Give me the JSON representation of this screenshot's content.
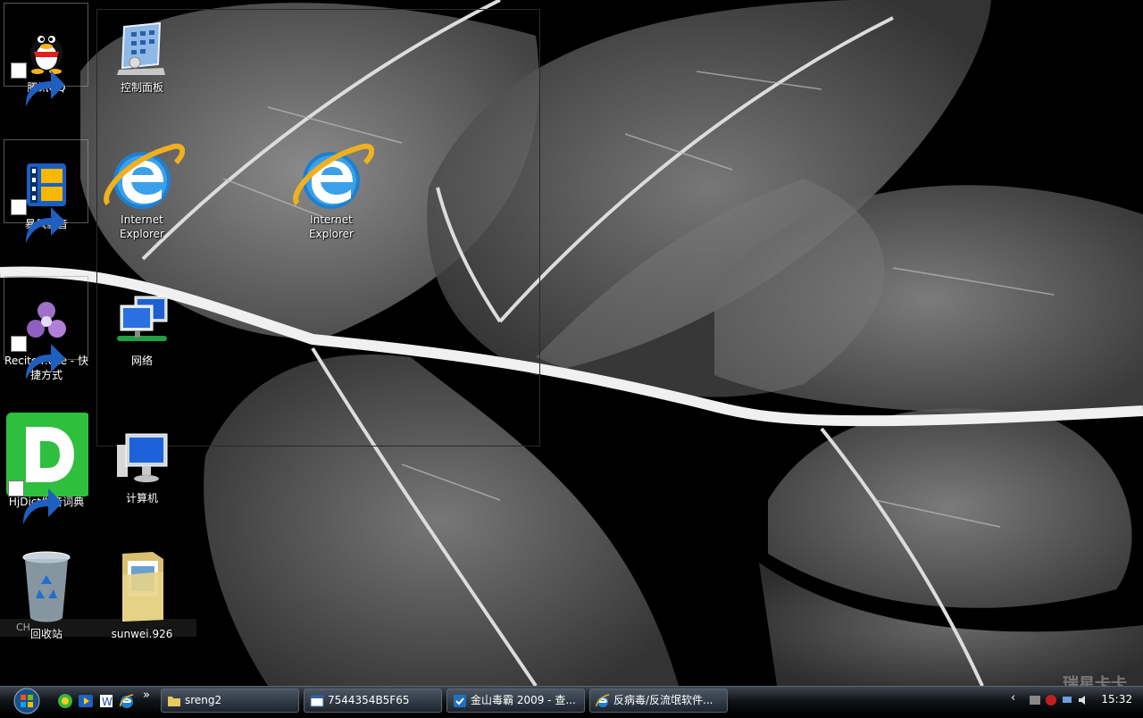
{
  "desktop": {
    "icons": [
      {
        "label": "腾讯QQ",
        "icon": "qq-penguin-icon",
        "shortcut": true
      },
      {
        "label": "控制面板",
        "icon": "control-panel-icon",
        "shortcut": false
      },
      {
        "label": "暴风影音",
        "icon": "storm-player-icon",
        "shortcut": true
      },
      {
        "label": "Internet Explorer",
        "icon": "internet-explorer-icon",
        "shortcut": false
      },
      {
        "label": "Internet Explorer",
        "icon": "internet-explorer-icon",
        "shortcut": false
      },
      {
        "label": "Recite4.exe - 快捷方式",
        "icon": "recite-app-icon",
        "shortcut": true
      },
      {
        "label": "网络",
        "icon": "network-icon",
        "shortcut": false
      },
      {
        "label": "HjDict发音词典",
        "icon": "hjdict-icon",
        "shortcut": true
      },
      {
        "label": "计算机",
        "icon": "computer-icon",
        "shortcut": false
      },
      {
        "label": "回收站",
        "icon": "recycle-bin-icon",
        "shortcut": false
      },
      {
        "label": "sunwei.926",
        "icon": "folder-icon",
        "shortcut": false
      }
    ]
  },
  "ime_bar": {
    "text": "CH"
  },
  "watermark": "瑞星卡卡",
  "taskbar": {
    "start_icon": "windows-orb-icon",
    "quick_launch": [
      {
        "icon": "360-browser-icon"
      },
      {
        "icon": "media-player-icon"
      },
      {
        "icon": "word-app-icon"
      },
      {
        "icon": "internet-explorer-icon"
      }
    ],
    "more_label": "»",
    "tasks": [
      {
        "label": "sreng2",
        "icon": "folder-icon"
      },
      {
        "label": "7544354B5F65",
        "icon": "window-app-icon"
      },
      {
        "label": "金山毒霸 2009 - 查...",
        "icon": "antivirus-icon"
      },
      {
        "label": "反病毒/反流氓软件...",
        "icon": "internet-explorer-icon"
      }
    ],
    "tray": {
      "expand_label": "‹",
      "clock": "15:32"
    }
  },
  "colors": {
    "taskbar": "#101418",
    "ie_blue": "#1e7fd0",
    "ie_ring": "#f0b020",
    "hjdict_green": "#2fbf3f"
  }
}
